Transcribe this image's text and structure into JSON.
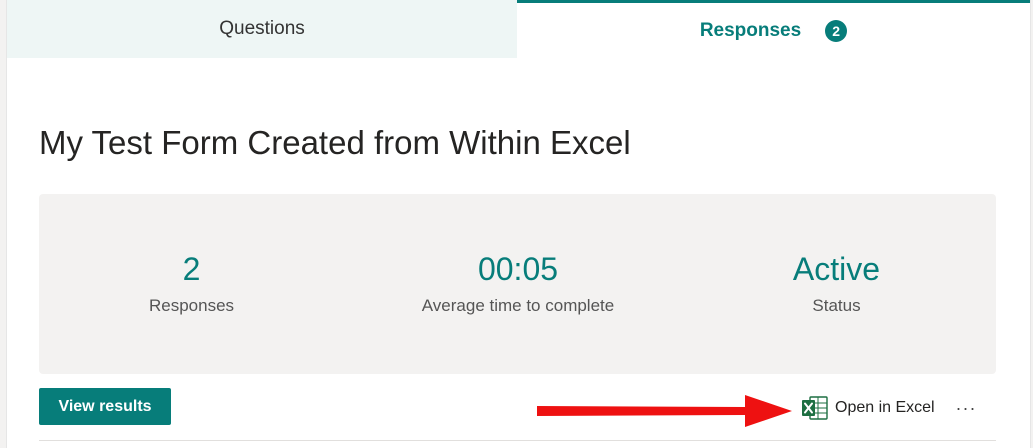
{
  "tabs": {
    "questions_label": "Questions",
    "responses_label": "Responses",
    "responses_count": "2"
  },
  "form": {
    "title": "My Test Form Created from Within Excel"
  },
  "summary": {
    "responses_value": "2",
    "responses_label": "Responses",
    "avg_time_value": "00:05",
    "avg_time_label": "Average time to complete",
    "status_value": "Active",
    "status_label": "Status"
  },
  "actions": {
    "view_results_label": "View results",
    "open_in_excel_label": "Open in Excel",
    "more_options_label": "···"
  },
  "icons": {
    "excel": "excel-icon",
    "arrow": "red-arrow"
  },
  "colors": {
    "accent": "#077d7a",
    "tab_inactive_bg": "#eef6f5",
    "summary_bg": "#f3f2f1",
    "annotation_arrow": "#ee1111"
  }
}
